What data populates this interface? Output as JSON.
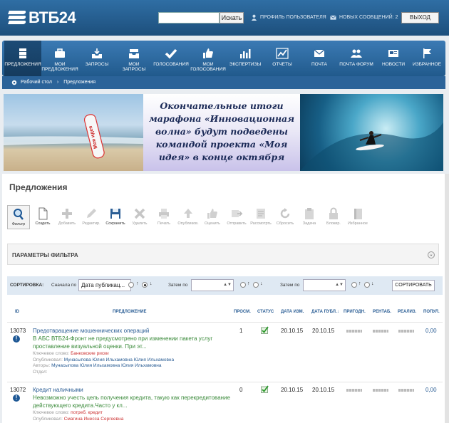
{
  "header": {
    "logo_text": "ВТБ24",
    "search_placeholder": "",
    "search_button": "Искать",
    "profile_link": "ПРОФИЛЬ ПОЛЬЗОВАТЕЛЯ",
    "messages_link": "НОВЫХ СООБЩЕНИЙ: 2",
    "logout_button": "ВЫХОД"
  },
  "nav": {
    "items": [
      {
        "label1": "",
        "label2": "ПРЕДЛОЖЕНИЯ",
        "icon": "server-icon"
      },
      {
        "label1": "МОИ",
        "label2": "ПРЕДЛОЖЕНИЯ",
        "icon": "briefcase-icon"
      },
      {
        "label1": "",
        "label2": "ЗАПРОСЫ",
        "icon": "inbox-icon"
      },
      {
        "label1": "МОИ",
        "label2": "ЗАПРОСЫ",
        "icon": "tray-icon"
      },
      {
        "label1": "",
        "label2": "ГОЛОСОВАНИЯ",
        "icon": "checkmark-icon"
      },
      {
        "label1": "МОИ",
        "label2": "ГОЛОСОВАНИЯ",
        "icon": "thumbs-up-icon"
      },
      {
        "label1": "",
        "label2": "ЭКСПЕРТИЗЫ",
        "icon": "bar-chart-icon"
      },
      {
        "label1": "",
        "label2": "ОТЧЕТЫ",
        "icon": "line-chart-icon"
      },
      {
        "label1": "",
        "label2": "ПОЧТА",
        "icon": "envelope-icon"
      },
      {
        "label1": "",
        "label2": "ПОЧТА ФОРУМ",
        "icon": "people-icon"
      },
      {
        "label1": "",
        "label2": "НОВОСТИ",
        "icon": "newspaper-icon"
      },
      {
        "label1": "",
        "label2": "ИЗБРАННОЕ",
        "icon": "flag-icon"
      }
    ]
  },
  "breadcrumb": {
    "root": "Рабочий стол",
    "separator": "›",
    "current": "Предложения"
  },
  "banner": {
    "line1": "Окончательные итоги",
    "line2": "марафона «Инновационная",
    "line3": "волна» будут подведены",
    "line4": "командой проекта «Моя",
    "line5": "идея» в конце октября",
    "sign_text": "Моя идея"
  },
  "page_title": "Предложения",
  "toolbar": {
    "items": [
      {
        "label": "Фильтр",
        "icon": "magnifier-icon",
        "enabled": true
      },
      {
        "label": "Создать",
        "icon": "document-icon",
        "enabled": true
      },
      {
        "label": "Добавить",
        "icon": "plus-icon",
        "enabled": false
      },
      {
        "label": "Редактир.",
        "icon": "pencil-icon",
        "enabled": false
      },
      {
        "label": "Сохранить",
        "icon": "floppy-icon",
        "enabled": true
      },
      {
        "label": "Удалить",
        "icon": "cross-icon",
        "enabled": false
      },
      {
        "label": "Печать",
        "icon": "printer-icon",
        "enabled": false
      },
      {
        "label": "Опубликов.",
        "icon": "upload-icon",
        "enabled": false
      },
      {
        "label": "Оценить",
        "icon": "thumb-icon",
        "enabled": false
      },
      {
        "label": "Отправить",
        "icon": "send-icon",
        "enabled": false
      },
      {
        "label": "Рассмотрть",
        "icon": "review-icon",
        "enabled": false
      },
      {
        "label": "Сбросить",
        "icon": "refresh-icon",
        "enabled": false
      },
      {
        "label": "Задача",
        "icon": "clipboard-icon",
        "enabled": false
      },
      {
        "label": "Блокир.",
        "icon": "lock-icon",
        "enabled": false
      },
      {
        "label": "Избранное",
        "icon": "book-icon",
        "enabled": false
      }
    ]
  },
  "filter": {
    "title": "ПАРАМЕТРЫ ФИЛЬТРА",
    "collapse_icon": "chevron-icon"
  },
  "sort": {
    "label": "СОРТИРОВКА:",
    "first_label": "Сначала по",
    "first_value": "Дата публикац...",
    "then_label1": "Затем по",
    "then_value1": "",
    "then_label2": "Затем по",
    "then_value2": "",
    "asc": "↑",
    "desc": "↓",
    "button": "СОРТИРОВАТЬ"
  },
  "table": {
    "headers": {
      "id": "ID",
      "proposal": "ПРЕДЛОЖЕНИЕ",
      "views": "ПРОСМ.",
      "status": "СТАТУС",
      "date_mod": "ДАТА ИЗМ.",
      "date_pub": "ДАТА ПУБЛ.",
      "sort_arrow": "↓",
      "suitable": "ПРИГОДН.",
      "profitable": "РЕНТАБ.",
      "feasible": "РЕАЛИЗ.",
      "popular": "ПОПУЛ."
    },
    "rows": [
      {
        "id": "13073",
        "title": "Предотвращение мошеннических операций",
        "desc1": "В АБС ВТБ24-Фронт не предусмотрено при изменении пакета услуг",
        "desc2": "проставление визуальной оценки. При эт...",
        "keyword_label": "Ключевое слово:",
        "keyword": "Банковские риски",
        "published_label": "Опубликовал:",
        "published": "Мунасыпова Юлия Ильхамовна Юлия Ильхамовна",
        "authors_label": "Авторы:",
        "authors": "Мунасыпова Юлия Ильхамовна Юлия Ильхамовна",
        "dept_label": "Отдел:",
        "views": "1",
        "date_mod": "20.10.15",
        "date_pub": "20.10.15",
        "popular": "0,00"
      },
      {
        "id": "13072",
        "title": "Кредит наличными",
        "desc1": "Невозможно учесть цель получения кредита, такую как перекредитование",
        "desc2": "действующего кредита.Часто у кл...",
        "keyword_label": "Ключевое слово:",
        "keyword": "потреб. кредит",
        "published_label": "Опубликовал:",
        "published": "Смагина Инесса Сергеевна",
        "views": "0",
        "date_mod": "20.10.15",
        "date_pub": "20.10.15",
        "popular": "0,00"
      }
    ]
  }
}
